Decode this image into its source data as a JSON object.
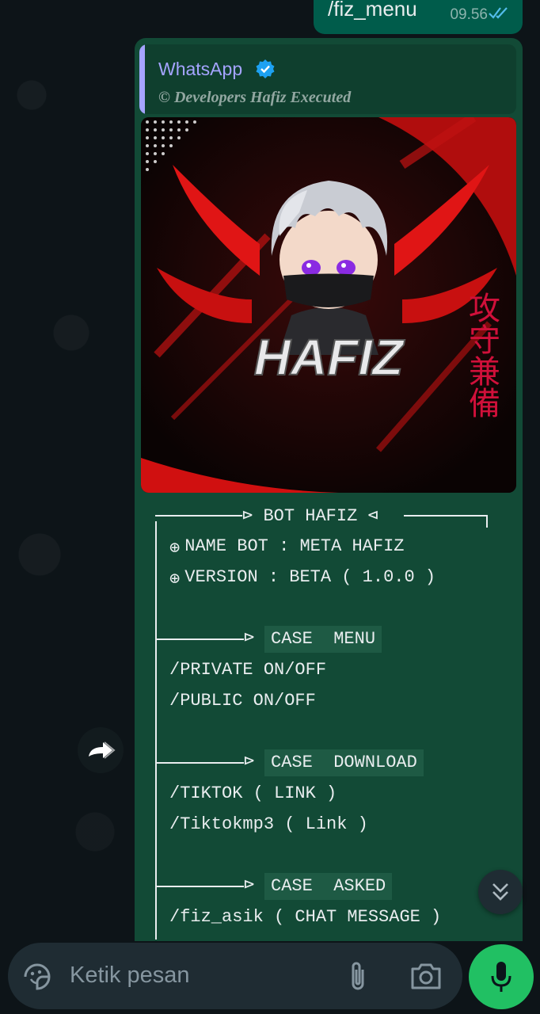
{
  "sent_message": {
    "text": "/fiz_menu",
    "time": "09.56"
  },
  "quoted": {
    "name": "WhatsApp",
    "subtitle": "© Developers Hafiz Executed"
  },
  "image": {
    "caption_text": "HAFIZ",
    "side_text": "攻守兼備"
  },
  "menu": {
    "header": "BOT HAFIZ",
    "name_line": "NAME BOT : META HAFIZ",
    "version_line": "VERSION : BETA ( 1.0.0 )",
    "sections": [
      {
        "title": "CASE  MENU",
        "items": [
          "/PRIVATE ON/OFF",
          "/PUBLIC ON/OFF"
        ]
      },
      {
        "title": "CASE  DOWNLOAD",
        "items": [
          "/TIKTOK ( LINK )",
          "/Tiktokmp3 ( Link )"
        ]
      },
      {
        "title": "CASE  ASKED",
        "items": [
          "/fiz_asik ( CHAT MESSAGE )"
        ]
      }
    ]
  },
  "composer": {
    "placeholder": "Ketik pesan"
  },
  "icons": {
    "forward": "forward-icon",
    "scroll_down": "double-chevron-down-icon",
    "sticker": "sticker-icon",
    "attach": "paperclip-icon",
    "camera": "camera-icon",
    "mic": "mic-icon",
    "verified": "verified-badge-icon",
    "read": "double-check-icon"
  },
  "colors": {
    "bubble_in": "#124a36",
    "bubble_out": "#005c4b",
    "accent": "#21c063",
    "quote_name": "#a5a4ff",
    "read_ticks": "#53bdeb"
  }
}
